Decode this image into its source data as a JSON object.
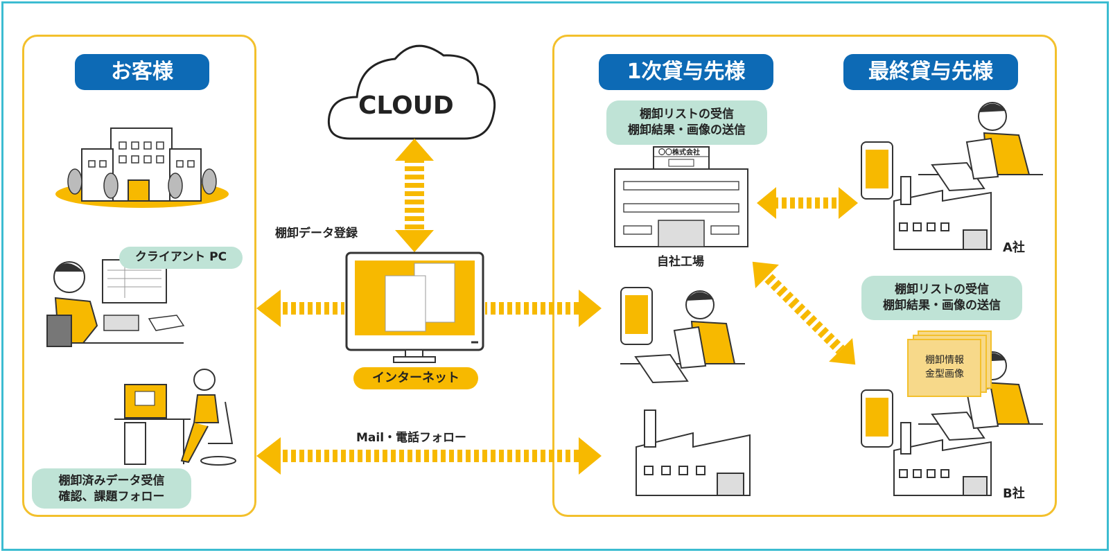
{
  "colors": {
    "frame": "#3cbcd1",
    "panel_border": "#f3c02c",
    "accent_yellow": "#f7b900",
    "label_blue": "#0d6ab5",
    "note_mint": "#bfe3d6"
  },
  "customer": {
    "title": "お客様",
    "client_pc": "クライアント PC",
    "note": [
      "棚卸済みデータ受信",
      "確認、課題フォロー"
    ]
  },
  "cloud": {
    "label": "CLOUD"
  },
  "center": {
    "register_label": "棚卸データ登録",
    "internet_label": "インターネット",
    "mail_label": "Mail・電話フォロー"
  },
  "primary": {
    "title": "1次貸与先様",
    "note": [
      "棚卸リストの受信",
      "棚卸結果・画像の送信"
    ],
    "company_sign": "〇〇株式会社",
    "factory_label": "自社工場"
  },
  "final": {
    "title": "最終貸与先様",
    "company_a": "A社",
    "company_b": "B社",
    "note": [
      "棚卸リストの受信",
      "棚卸結果・画像の送信"
    ],
    "doc_label": [
      "棚卸情報",
      "金型画像"
    ]
  },
  "icons": [
    "building-icon",
    "person-at-pc-icon",
    "woman-at-desk-icon",
    "cloud-icon",
    "monitor-icon",
    "factory-icon",
    "smartphone-icon",
    "businessman-icon",
    "laptop-icon",
    "document-stack-icon",
    "double-arrow-icon"
  ]
}
